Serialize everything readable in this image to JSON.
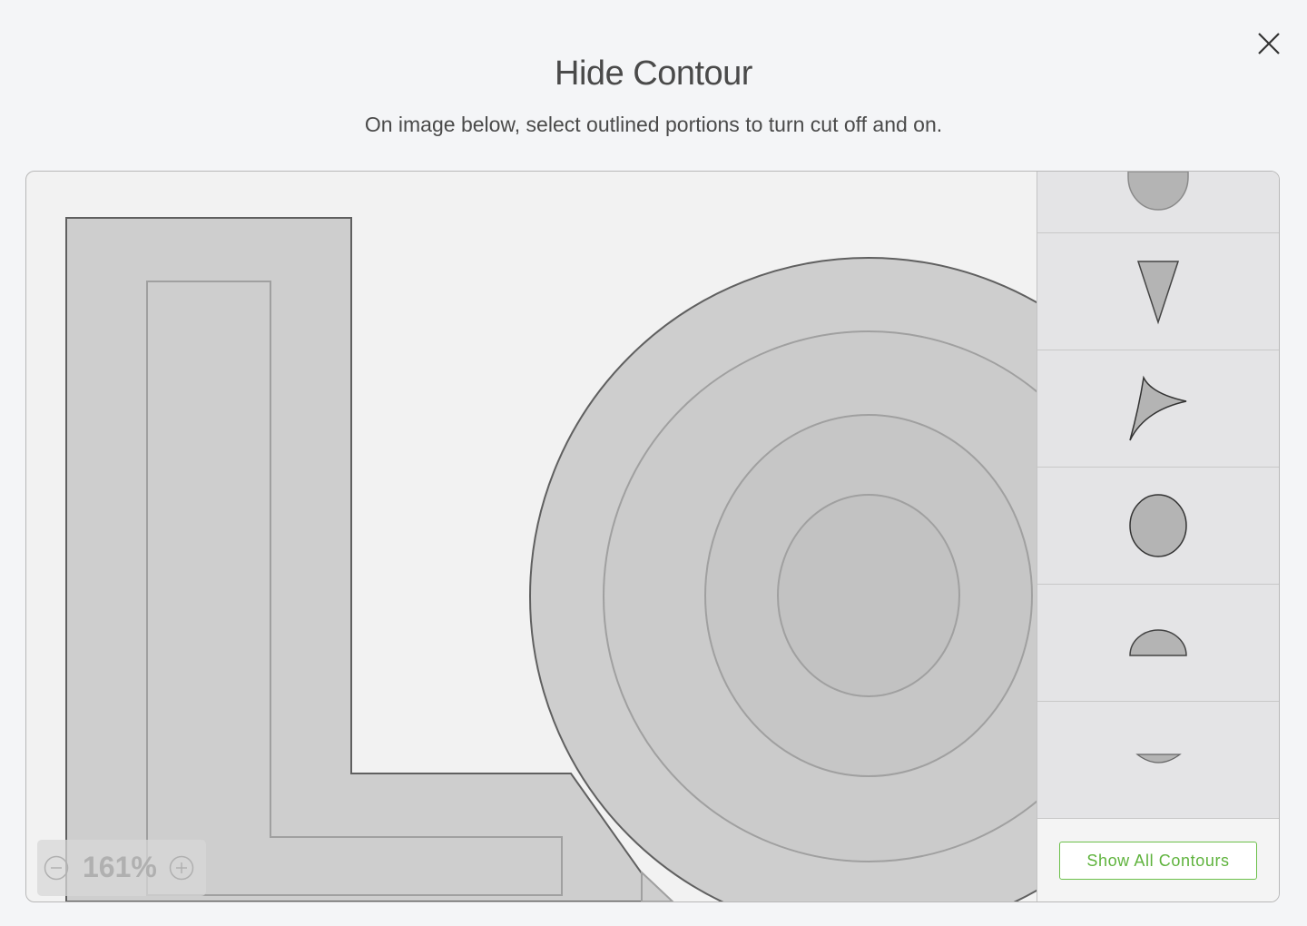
{
  "dialog": {
    "title": "Hide Contour",
    "subtitle": "On image below, select outlined portions to turn cut off and on."
  },
  "icons": {
    "close": "close-icon",
    "zoom_out": "minus-circle-icon",
    "zoom_in": "plus-circle-icon"
  },
  "zoom": {
    "value": "161%"
  },
  "contour_list": {
    "items": [
      {
        "shape": "oval-partial"
      },
      {
        "shape": "inverted-triangle"
      },
      {
        "shape": "curved-arrowhead"
      },
      {
        "shape": "circle"
      },
      {
        "shape": "semicircle"
      },
      {
        "shape": "small-sliver"
      }
    ],
    "show_all_label": "Show All Contours"
  },
  "colors": {
    "background": "#f4f5f7",
    "accent_green": "#6cc04a",
    "shape_fill": "#cecece",
    "thumbnail_fill": "#b4b4b4"
  }
}
